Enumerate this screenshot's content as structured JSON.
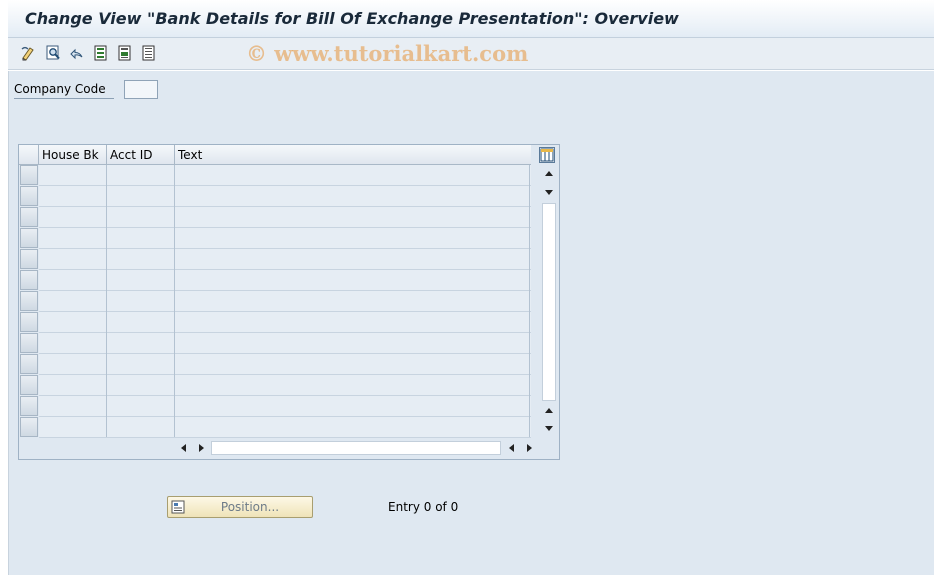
{
  "window": {
    "title": "Change View \"Bank Details for Bill Of Exchange Presentation\": Overview"
  },
  "toolbar": {
    "buttons": [
      {
        "name": "display-change-icon"
      },
      {
        "name": "details-icon"
      },
      {
        "name": "undo-change-icon"
      },
      {
        "name": "select-all-icon"
      },
      {
        "name": "select-block-icon"
      },
      {
        "name": "deselect-all-icon"
      }
    ],
    "watermark": "© www.tutorialkart.com"
  },
  "filter": {
    "company_code_label": "Company Code",
    "company_code_value": ""
  },
  "table": {
    "columns": [
      "House Bk",
      "Acct ID",
      "Text"
    ],
    "visible_row_count": 13,
    "rows": []
  },
  "footer": {
    "position_button_label": "Position...",
    "entry_text": "Entry 0 of 0"
  }
}
